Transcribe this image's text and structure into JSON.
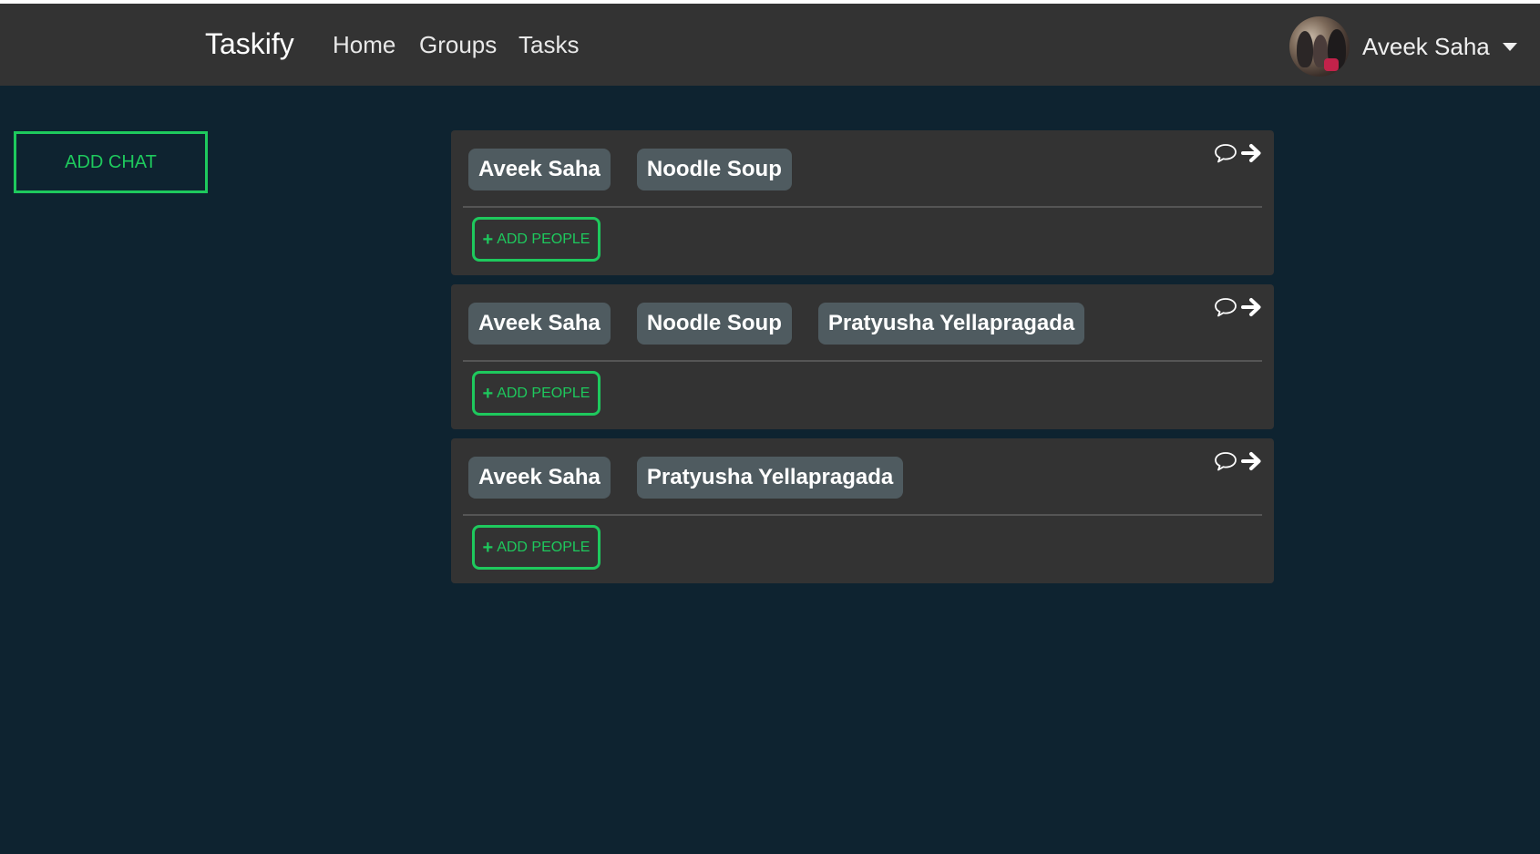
{
  "navbar": {
    "brand": "Taskify",
    "links": [
      "Home",
      "Groups",
      "Tasks"
    ],
    "user_name": "Aveek Saha"
  },
  "sidebar": {
    "add_chat_label": "ADD CHAT"
  },
  "chats": [
    {
      "members": [
        "Aveek Saha",
        "Noodle Soup"
      ],
      "add_people_label": "ADD PEOPLE"
    },
    {
      "members": [
        "Aveek Saha",
        "Noodle Soup",
        "Pratyusha Yellapragada"
      ],
      "add_people_label": "ADD PEOPLE"
    },
    {
      "members": [
        "Aveek Saha",
        "Pratyusha Yellapragada"
      ],
      "add_people_label": "ADD PEOPLE"
    }
  ],
  "icons": {
    "chat": "speech-bubble-icon",
    "open": "arrow-right-icon",
    "add": "plus-icon",
    "menu": "caret-down-icon"
  },
  "colors": {
    "background": "#0e2330",
    "navbar": "#333333",
    "card": "#333333",
    "chip": "#4f5b60",
    "accent": "#1ec95d"
  }
}
